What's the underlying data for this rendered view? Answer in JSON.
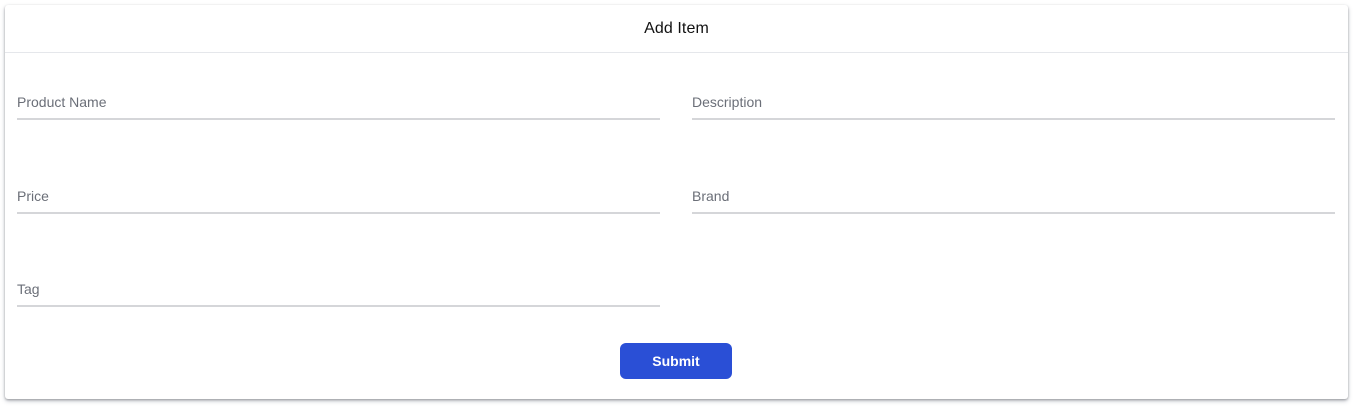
{
  "header": {
    "title": "Add Item"
  },
  "form": {
    "fields": {
      "product_name": {
        "label": "Product Name",
        "value": ""
      },
      "description": {
        "label": "Description",
        "value": ""
      },
      "price": {
        "label": "Price",
        "value": ""
      },
      "brand": {
        "label": "Brand",
        "value": ""
      },
      "tag": {
        "label": "Tag",
        "value": ""
      }
    },
    "submit_label": "Submit"
  },
  "colors": {
    "accent": "#2a4fd6",
    "label": "#6b6f78",
    "underline": "#d5d6d9"
  }
}
